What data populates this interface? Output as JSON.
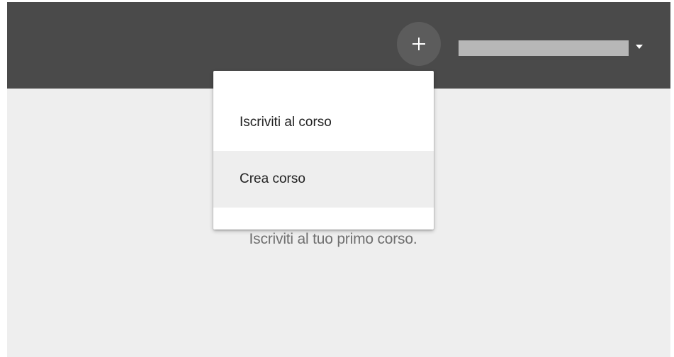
{
  "header": {
    "add_button_icon": "plus-icon",
    "account_dropdown_icon": "caret-down-icon"
  },
  "menu": {
    "items": [
      {
        "label": "Iscriviti al corso",
        "highlighted": false
      },
      {
        "label": "Crea corso",
        "highlighted": true
      }
    ]
  },
  "main": {
    "empty_message": "Iscriviti al tuo primo corso."
  },
  "colors": {
    "topbar": "#4a4a4a",
    "content_background": "#eeeeee",
    "menu_background": "#ffffff",
    "menu_highlight": "#eeeeee"
  }
}
